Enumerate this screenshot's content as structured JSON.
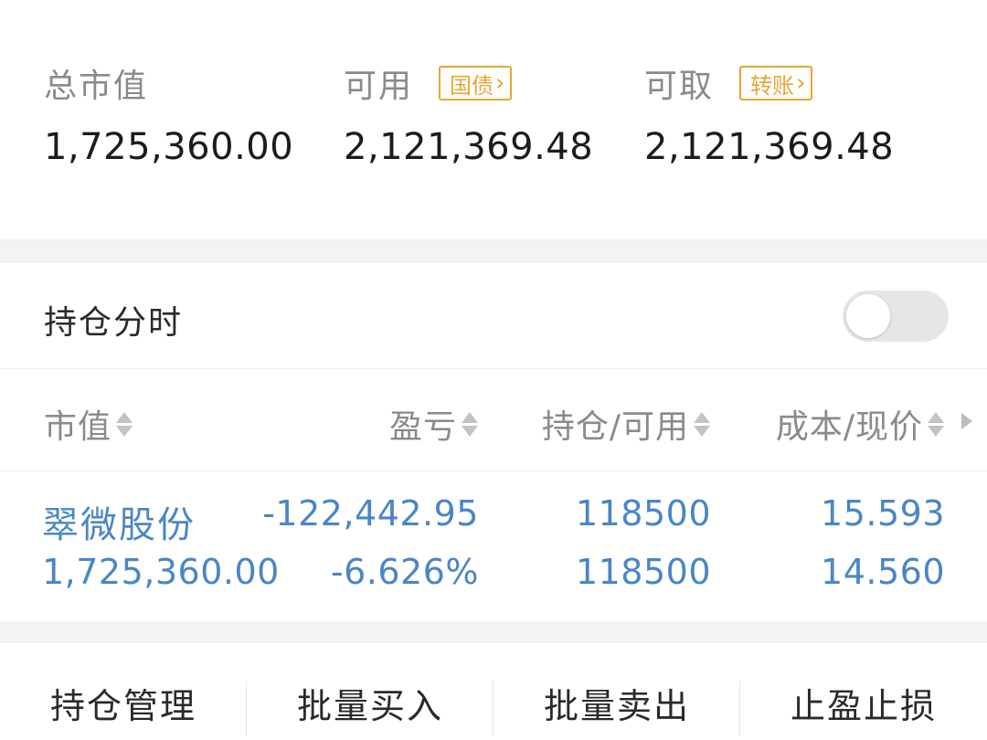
{
  "summary": {
    "total_market_value": {
      "label": "总市值",
      "value": "1,725,360.00"
    },
    "available": {
      "label": "可用",
      "tag": "国债",
      "value": "2,121,369.48"
    },
    "withdrawable": {
      "label": "可取",
      "tag": "转账",
      "value": "2,121,369.48"
    }
  },
  "position_timeshare": {
    "label": "持仓分时",
    "enabled": false
  },
  "table": {
    "headers": [
      "市值",
      "盈亏",
      "持仓/可用",
      "成本/现价"
    ],
    "rows": [
      {
        "name": "翠微股份",
        "market_value": "1,725,360.00",
        "profit_loss": "-122,442.95",
        "profit_loss_ratio": "-6.626%",
        "position": "118500",
        "available": "118500",
        "cost": "15.593",
        "price": "14.560"
      }
    ]
  },
  "actions": [
    "持仓管理",
    "批量买入",
    "批量卖出",
    "止盈止损"
  ],
  "colors": {
    "tag_accent": "#e4a732",
    "holding_text": "#4a86c5",
    "label_gray": "#8a8a8a",
    "section_gap": "#f3f3f3"
  }
}
